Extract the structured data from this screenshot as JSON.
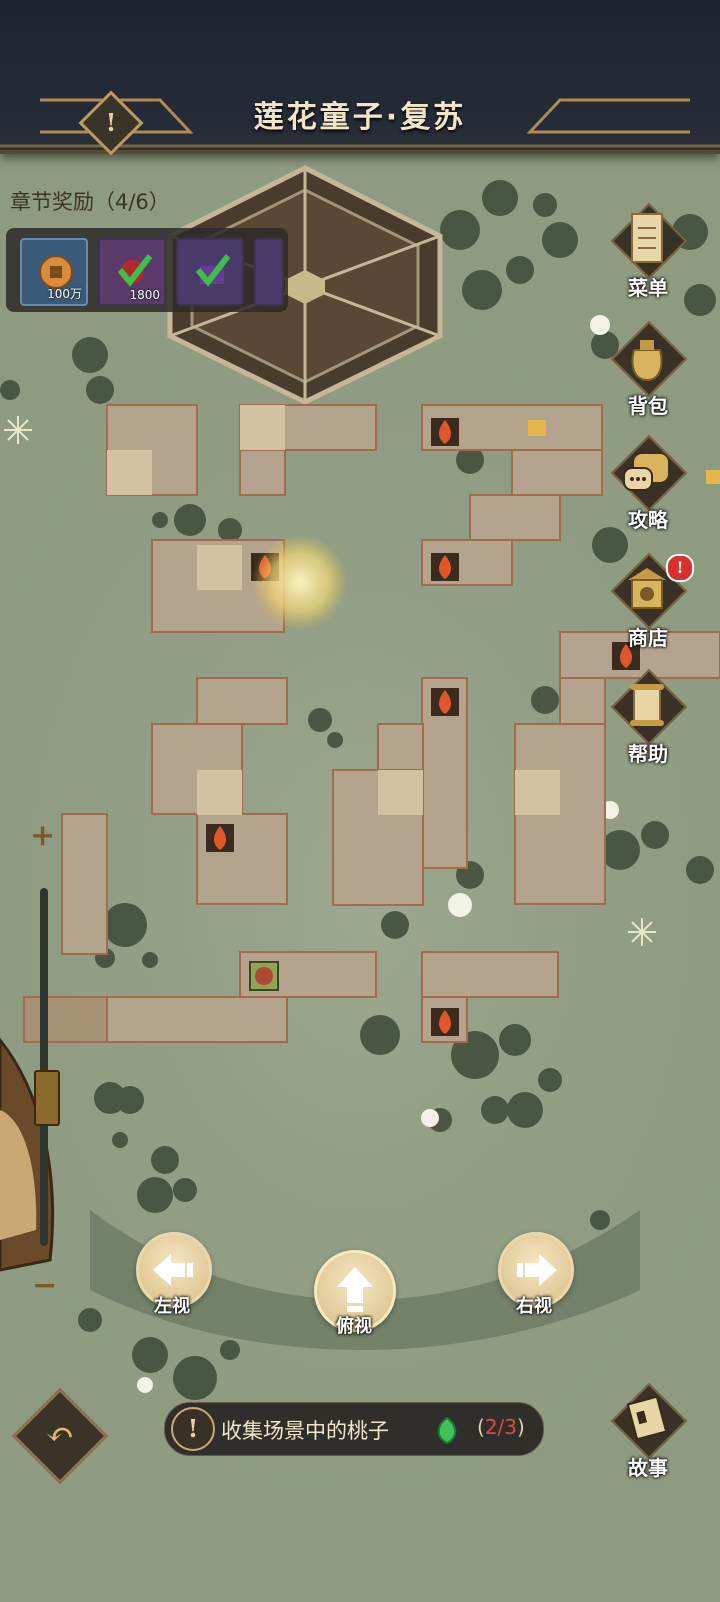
{
  "header": {
    "title": "莲花童子·复苏",
    "info_icon": "exclamation-icon"
  },
  "rewards": {
    "title": "章节奖励（4/6）",
    "items": [
      {
        "icon": "copper-coin-icon",
        "quantity": "100万",
        "claimed": false
      },
      {
        "icon": "red-gem-icon",
        "quantity": "1800",
        "claimed": true
      },
      {
        "icon": "purple-chest-icon",
        "quantity": "",
        "claimed": true
      }
    ]
  },
  "menu": {
    "items": [
      {
        "label": "菜单",
        "icon": "scroll-menu-icon"
      },
      {
        "label": "背包",
        "icon": "bag-icon"
      },
      {
        "label": "攻略",
        "icon": "chat-bubble-icon"
      },
      {
        "label": "商店",
        "icon": "shop-icon",
        "badge": "!"
      },
      {
        "label": "帮助",
        "icon": "help-scroll-icon"
      }
    ]
  },
  "views": {
    "left": "左视",
    "top": "俯视",
    "right": "右视"
  },
  "objective": {
    "text": "收集场景中的桃子",
    "progress_open": "(",
    "progress_current": "2/3",
    "progress_close": ")"
  },
  "story": {
    "label": "故事",
    "icon": "story-book-icon"
  },
  "zoom": {
    "plus": "+",
    "minus": "−"
  },
  "colors": {
    "water": "#8e9b80",
    "floor": "#b5a48d",
    "header": "#1e2430",
    "accent_gold": "#c9ab73",
    "progress_red": "#e04848"
  }
}
